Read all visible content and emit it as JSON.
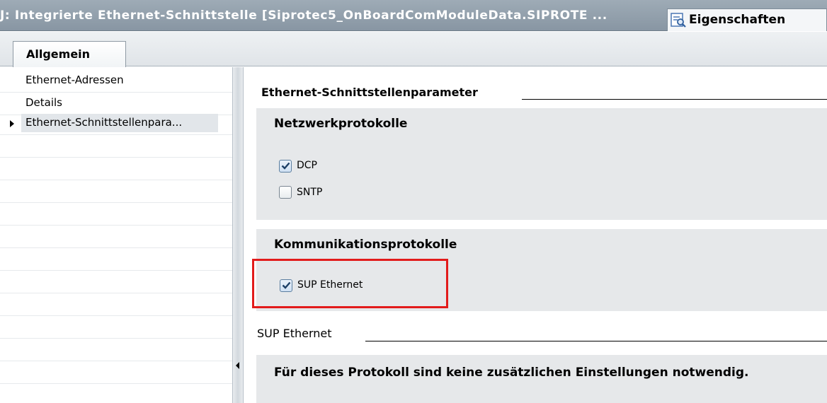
{
  "titlebar": {
    "title": "J: Integrierte Ethernet-Schnittstelle  [Siprotec5_OnBoardComModuleData.SIPROTE ...",
    "properties_label": "Eigenschaften",
    "properties_icon": "properties-magnifier-icon"
  },
  "tabs": [
    {
      "label": "Allgemein",
      "active": true
    }
  ],
  "nav": {
    "items": [
      {
        "label": "Ethernet-Adressen",
        "selected": false
      },
      {
        "label": "Details",
        "selected": false
      },
      {
        "label": "Ethernet-Schnittstellenpara...",
        "selected": true
      }
    ]
  },
  "main": {
    "section_header": "Ethernet-Schnittstellenparameter",
    "network_group": {
      "title": "Netzwerkprotokolle",
      "items": [
        {
          "label": "DCP",
          "checked": true
        },
        {
          "label": "SNTP",
          "checked": false
        }
      ]
    },
    "comm_group": {
      "title": "Kommunikationsprotokolle",
      "items": [
        {
          "label": "SUP Ethernet",
          "checked": true
        }
      ]
    },
    "sup_header": "SUP Ethernet",
    "sup_info": "Für dieses Protokoll sind keine zusätzlichen Einstellungen notwendig."
  },
  "colors": {
    "highlight": "#e21b1b",
    "group_bg": "#e6e8ea",
    "titlebar_bg": "#8f9daa"
  }
}
